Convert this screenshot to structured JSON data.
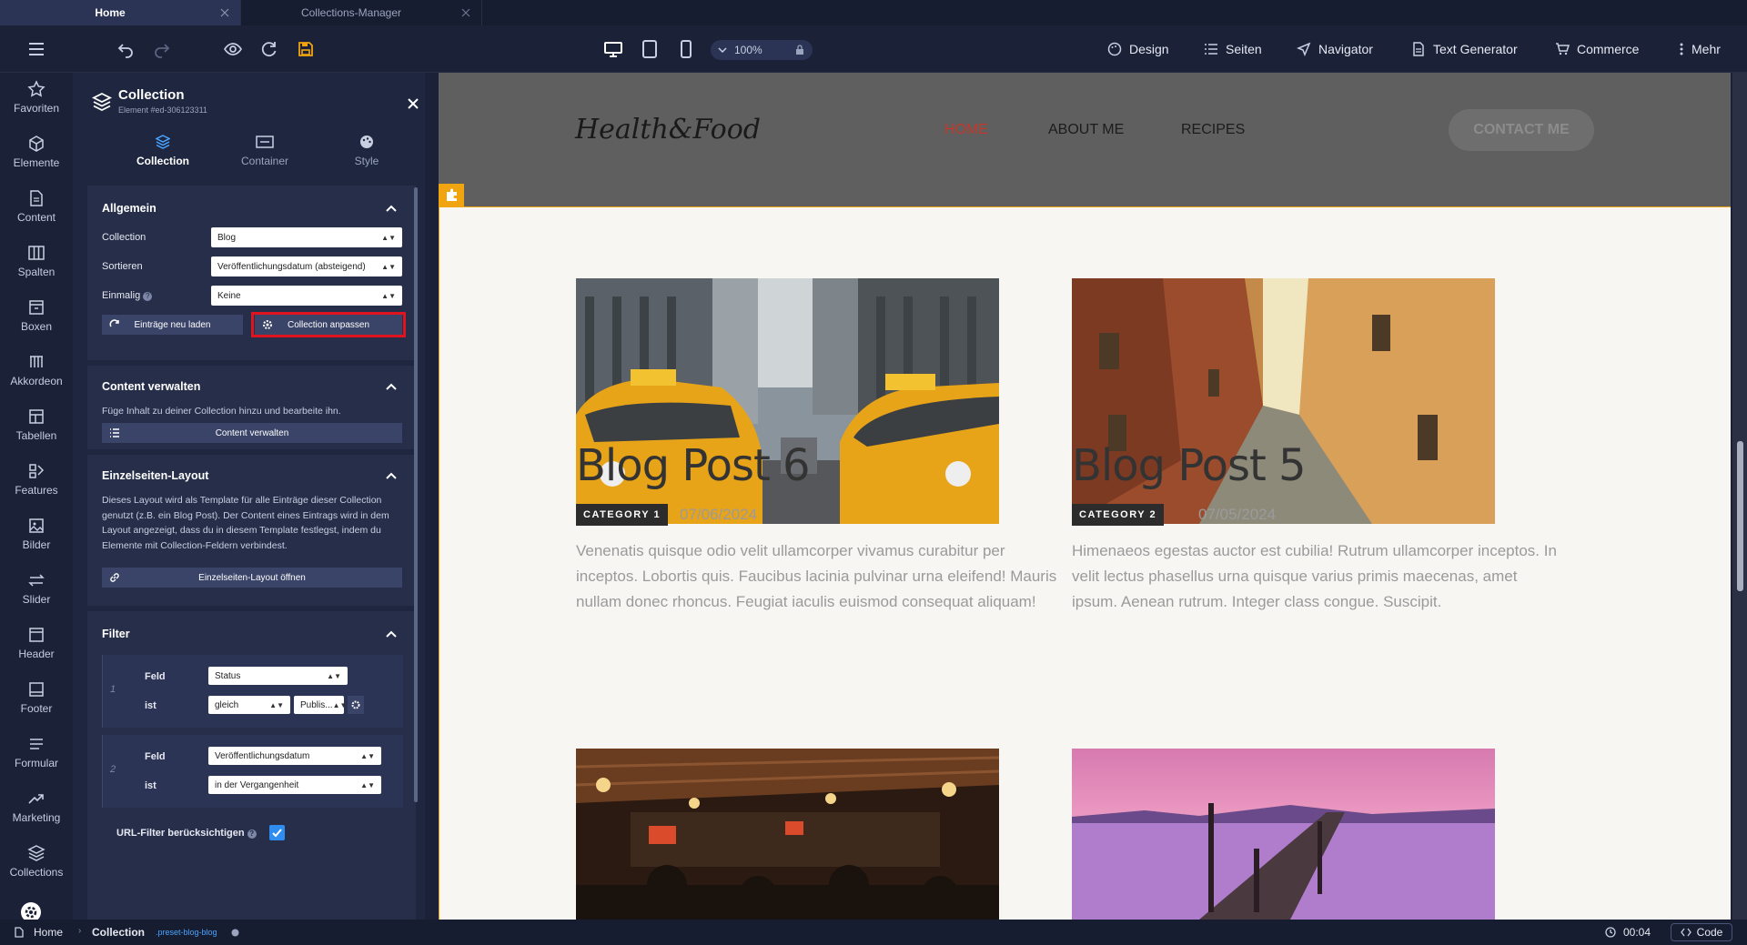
{
  "tabs": [
    {
      "label": "Home",
      "active": true
    },
    {
      "label": "Collections-Manager",
      "active": false
    }
  ],
  "toolbar": {
    "zoom": "100%",
    "menu": [
      "Design",
      "Seiten",
      "Navigator",
      "Text Generator",
      "Commerce",
      "Mehr"
    ]
  },
  "rail": [
    "Favoriten",
    "Elemente",
    "Content",
    "Spalten",
    "Boxen",
    "Akkordeon",
    "Tabellen",
    "Features",
    "Bilder",
    "Slider",
    "Header",
    "Footer",
    "Formular",
    "Marketing",
    "Collections"
  ],
  "panel": {
    "title": "Collection",
    "subtitle": "Element #ed-306123311",
    "tabs": [
      "Collection",
      "Container",
      "Style"
    ],
    "allgemein": {
      "heading": "Allgemein",
      "collection_label": "Collection",
      "collection_value": "Blog",
      "sort_label": "Sortieren",
      "sort_value": "Veröffentlichungsdatum (absteigend)",
      "once_label": "Einmalig",
      "once_value": "Keine",
      "reload_button": "Einträge neu laden",
      "adjust_button": "Collection anpassen"
    },
    "content": {
      "heading": "Content verwalten",
      "desc": "Füge Inhalt zu deiner Collection hinzu und bearbeite ihn.",
      "button": "Content verwalten"
    },
    "layout": {
      "heading": "Einzelseiten-Layout",
      "desc": "Dieses Layout wird als Template für alle Einträge dieser Collection genutzt (z.B. ein Blog Post). Der Content eines Eintrags wird in dem Layout angezeigt, dass du in diesem Template festlegst, indem du Elemente mit Collection-Feldern verbindest.",
      "button": "Einzelseiten-Layout öffnen"
    },
    "filter": {
      "heading": "Filter",
      "rows": [
        {
          "num": "1",
          "field_label": "Feld",
          "field_value": "Status",
          "op_label": "ist",
          "op_value": "gleich",
          "val": "Publis..."
        },
        {
          "num": "2",
          "field_label": "Feld",
          "field_value": "Veröffentlichungsdatum",
          "op_label": "ist",
          "op_value": "in der Vergangenheit"
        }
      ],
      "url_filter": "URL-Filter berücksichtigen"
    }
  },
  "site": {
    "logo": "Health&Food",
    "nav": [
      "HOME",
      "ABOUT ME",
      "RECIPES"
    ],
    "contact": "CONTACT ME",
    "posts": [
      {
        "title": "Blog Post 6",
        "category": "CATEGORY 1",
        "date": "07/06/2024",
        "excerpt": "Venenatis quisque odio velit ullamcorper vivamus curabitur per inceptos. Lobortis quis. Faucibus lacinia pulvinar urna eleifend! Mauris nullam donec rhoncus. Feugiat iaculis euismod consequat aliquam!"
      },
      {
        "title": "Blog Post 5",
        "category": "CATEGORY 2",
        "date": "07/05/2024",
        "excerpt": "Himenaeos egestas auctor est cubilia! Rutrum ullamcorper inceptos. In velit lectus phasellus urna quisque varius primis maecenas, amet ipsum. Aenean rutrum. Integer class congue. Suscipit."
      }
    ]
  },
  "status": {
    "home": "Home",
    "collection": "Collection",
    "collection_class": ".preset-blog-blog",
    "timer": "00:04",
    "code": "Code"
  },
  "colors": {
    "accent": "#f0a410",
    "highlight": "#e0141e",
    "nav_active": "#c0392b"
  }
}
